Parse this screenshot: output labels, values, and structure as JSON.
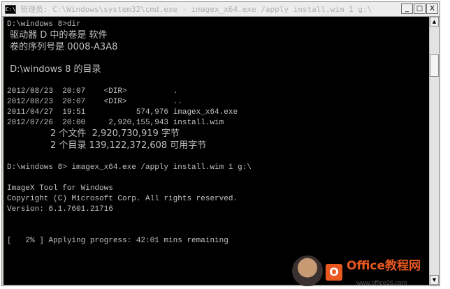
{
  "window": {
    "title": "管理员: C:\\Windows\\system32\\cmd.exe - imagex_x64.exe  /apply install.wim 1 g:\\",
    "icon_label": "C:\\",
    "buttons": {
      "minimize": "_",
      "maximize": "□",
      "close": "X"
    }
  },
  "console": {
    "lines": [
      "D:\\windows 8>dir",
      " 驱动器 D 中的卷是 软件",
      " 卷的序列号是 0008-A3A8",
      "",
      " D:\\windows 8 的目录",
      "",
      "2012/08/23  20:07    <DIR>          .",
      "2012/08/23  20:07    <DIR>          ..",
      "2011/04/27  19:51           574,976 imagex_x64.exe",
      "2012/07/26  20:00     2,920,155,943 install.wim",
      "               2 个文件  2,920,730,919 字节",
      "               2 个目录 139,122,372,608 可用字节",
      "",
      "D:\\windows 8> imagex_x64.exe /apply install.wim 1 g:\\",
      "",
      "ImageX Tool for Windows",
      "Copyright (C) Microsoft Corp. All rights reserved.",
      "Version: 6.1.7601.21716",
      "",
      "",
      "[   2% ] Applying progress: 42:01 mins remaining"
    ]
  },
  "scrollbar": {
    "up": "▲",
    "down": "▼"
  },
  "watermark": {
    "logo": "O",
    "title": "Office教程网",
    "url": "www.office26.com"
  }
}
